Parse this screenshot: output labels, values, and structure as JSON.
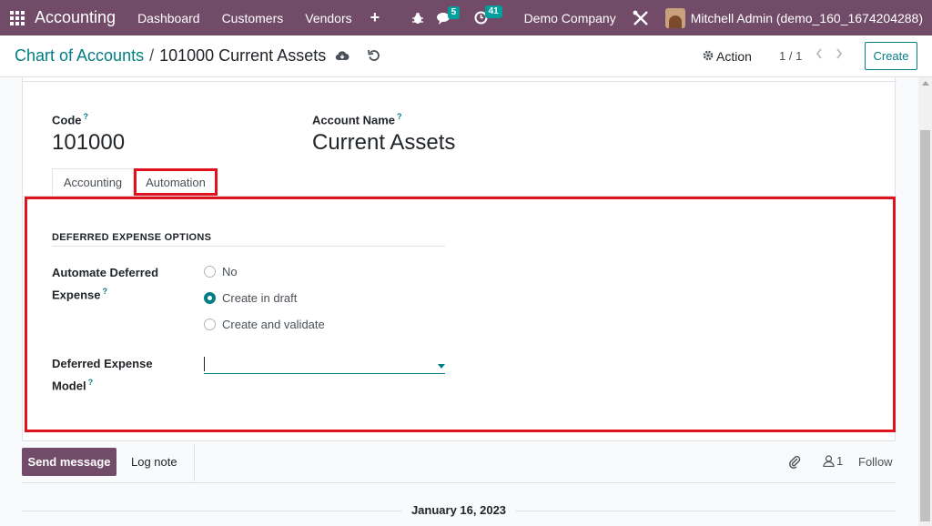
{
  "navbar": {
    "app_name": "Accounting",
    "menu": [
      "Dashboard",
      "Customers",
      "Vendors"
    ],
    "plus_label": "+",
    "messages_badge": "5",
    "activity_badge": "41",
    "company": "Demo Company",
    "user": "Mitchell Admin (demo_160_1674204288)"
  },
  "control_panel": {
    "breadcrumb_parent": "Chart of Accounts",
    "breadcrumb_separator": "/",
    "breadcrumb_current": "101000 Current Assets",
    "action_label": "Action",
    "pager": "1 / 1",
    "create_label": "Create"
  },
  "form": {
    "code_label": "Code",
    "code_value": "101000",
    "name_label": "Account Name",
    "name_value": "Current Assets",
    "help_mark": "?",
    "tabs": [
      "Accounting",
      "Automation"
    ],
    "active_tab": "Automation",
    "section_title": "DEFERRED EXPENSE OPTIONS",
    "automate_label_line1": "Automate Deferred",
    "automate_label_line2": "Expense",
    "radio_options": [
      "No",
      "Create in draft",
      "Create and validate"
    ],
    "radio_selected": "Create in draft",
    "model_label_line1": "Deferred Expense",
    "model_label_line2": "Model",
    "model_value": ""
  },
  "chatter": {
    "send_message": "Send message",
    "log_note": "Log note",
    "followers_count": "1",
    "follow": "Follow",
    "date_separator": "January 16, 2023"
  },
  "colors": {
    "navbar": "#714B67",
    "accent": "#017e84",
    "highlight": "#e0121e",
    "badge": "#00A09D"
  }
}
